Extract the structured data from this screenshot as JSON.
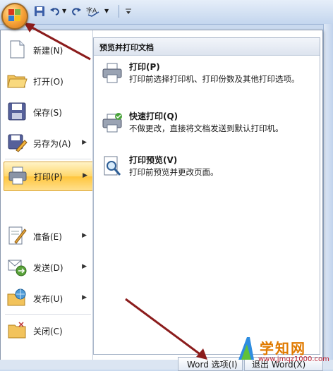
{
  "quick_access": {
    "icons": [
      "office-button-icon",
      "save-icon",
      "undo-icon",
      "redo-icon",
      "spelling-icon",
      "customize-icon"
    ]
  },
  "menu": {
    "items": [
      {
        "label": "新建(N)",
        "icon": "new-document-icon",
        "submenu": false
      },
      {
        "label": "打开(O)",
        "icon": "open-folder-icon",
        "submenu": false
      },
      {
        "label": "保存(S)",
        "icon": "save-disk-icon",
        "submenu": false
      },
      {
        "label": "另存为(A)",
        "icon": "save-as-icon",
        "submenu": true
      },
      {
        "label": "打印(P)",
        "icon": "print-icon",
        "submenu": true,
        "active": true
      },
      {
        "label": "准备(E)",
        "icon": "prepare-icon",
        "submenu": true
      },
      {
        "label": "发送(D)",
        "icon": "send-icon",
        "submenu": true
      },
      {
        "label": "发布(U)",
        "icon": "publish-icon",
        "submenu": true
      },
      {
        "label": "关闭(C)",
        "icon": "close-folder-icon",
        "submenu": false
      }
    ]
  },
  "print_pane": {
    "header": "预览并打印文档",
    "options": [
      {
        "title": "打印(P)",
        "desc": "打印前选择打印机、打印份数及其他打印选项。",
        "icon": "printer-icon"
      },
      {
        "title": "快速打印(Q)",
        "desc": "不做更改，直接将文档发送到默认打印机。",
        "icon": "quick-print-icon"
      },
      {
        "title": "打印预览(V)",
        "desc": "打印前预览并更改页面。",
        "icon": "print-preview-icon"
      }
    ]
  },
  "footer": {
    "word_options": "Word 选项(I)",
    "exit_word": "退出 Word(X)"
  },
  "watermark": {
    "title": "学知网",
    "url": "www.jmqz1000.com"
  },
  "colors": {
    "active_highlight": "#ffc53b",
    "annotation_arrow": "#8b1c1c",
    "watermark_orange": "#e07a00"
  }
}
